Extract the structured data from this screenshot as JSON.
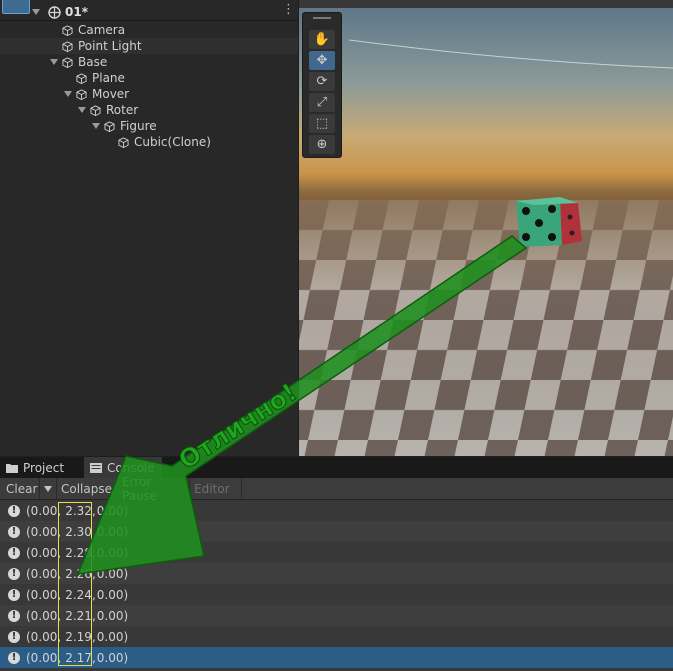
{
  "hierarchy": {
    "scene_name": "01*",
    "items": [
      {
        "label": "Camera",
        "depth": 0,
        "expandable": false
      },
      {
        "label": "Point Light",
        "depth": 0,
        "expandable": false,
        "selected": true
      },
      {
        "label": "Base",
        "depth": 0,
        "expandable": true
      },
      {
        "label": "Plane",
        "depth": 1,
        "expandable": false
      },
      {
        "label": "Mover",
        "depth": 1,
        "expandable": true
      },
      {
        "label": "Roter",
        "depth": 2,
        "expandable": true
      },
      {
        "label": "Figure",
        "depth": 3,
        "expandable": true
      },
      {
        "label": "Cubic(Clone)",
        "depth": 4,
        "expandable": false
      }
    ]
  },
  "scene_tools": [
    "hand-tool-icon",
    "move-tool-icon",
    "rotate-tool-icon",
    "scale-tool-icon",
    "rect-tool-icon",
    "transform-tool-icon"
  ],
  "tabs": {
    "project": "Project",
    "console": "Console"
  },
  "console_toolbar": {
    "clear": "Clear",
    "collapse": "Collapse",
    "error_pause": "Error Pause",
    "editor": "Editor"
  },
  "log_rows": [
    {
      "prefix": "(0.00,",
      "value": "2.32,",
      "suffix": "0.00)"
    },
    {
      "prefix": "(0.00,",
      "value": "2.30,",
      "suffix": "0.00)"
    },
    {
      "prefix": "(0.00,",
      "value": "2.28,",
      "suffix": "0.00)"
    },
    {
      "prefix": "(0.00,",
      "value": "2.26,",
      "suffix": "0.00)"
    },
    {
      "prefix": "(0.00,",
      "value": "2.24,",
      "suffix": "0.00)"
    },
    {
      "prefix": "(0.00,",
      "value": "2.21,",
      "suffix": "0.00)"
    },
    {
      "prefix": "(0.00,",
      "value": "2.19,",
      "suffix": "0.00)"
    },
    {
      "prefix": "(0.00,",
      "value": "2.17,",
      "suffix": "0.00)"
    }
  ],
  "annotation": {
    "text": "Отлично!",
    "color": "#1f8f1f"
  },
  "colors": {
    "selection": "#2c5d87",
    "highlight_box": "#e3e04a",
    "active_tool": "#41678f"
  }
}
